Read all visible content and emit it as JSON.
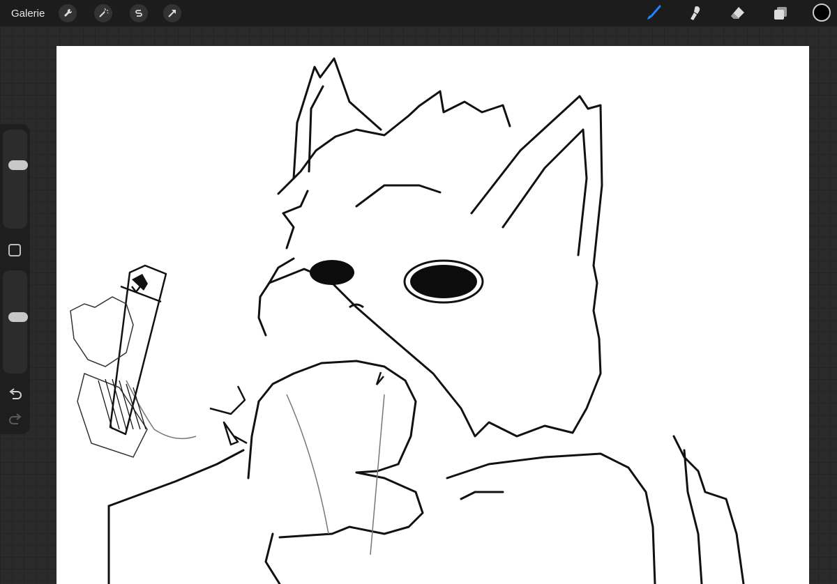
{
  "topbar": {
    "gallery_label": "Galerie",
    "left_tools": [
      "wrench-icon",
      "magic-wand-icon",
      "selection-s-icon",
      "transform-arrow-icon"
    ],
    "right_tools": [
      "brush-icon",
      "smudge-icon",
      "eraser-icon",
      "layers-icon"
    ],
    "active_tool": "brush-icon",
    "active_color": "#000000",
    "accent_color": "#1e84ff"
  },
  "sidebar": {
    "brush_size_level": 0.36,
    "opacity_level": 0.55,
    "actions": [
      "modify-square-icon",
      "undo-icon",
      "redo-icon"
    ]
  },
  "canvas": {
    "background": "#ffffff",
    "stroke_color": "#111111"
  }
}
